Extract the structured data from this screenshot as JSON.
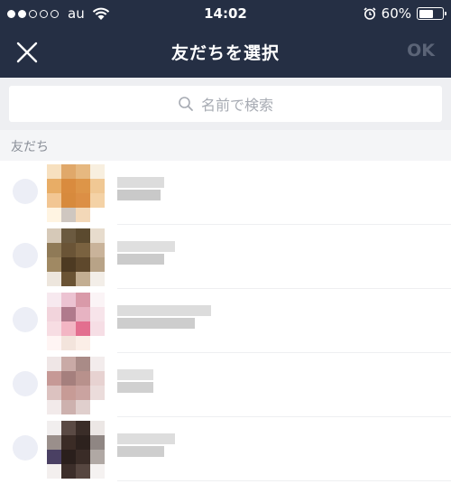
{
  "status_bar": {
    "carrier": "au",
    "time": "14:02",
    "battery": "60%",
    "battery_level": 0.6,
    "signal_filled": 2,
    "signal_total": 5
  },
  "nav": {
    "title": "友だちを選択",
    "ok_label": "OK"
  },
  "search": {
    "placeholder": "名前で検索"
  },
  "section": {
    "label": "友だち"
  },
  "friends": [
    {
      "avatar": [
        "#f7e0bf",
        "#e0a86a",
        "#e6b880",
        "#f8efdf",
        "#e8ad66",
        "#d98b3e",
        "#dd9548",
        "#f0c894",
        "#f2c693",
        "#d78a3d",
        "#dc8f45",
        "#f4d2a6",
        "#fff4e2",
        "#cfc7c0",
        "#f3d8b8",
        "#ffffff"
      ],
      "name": [
        "#dcdcdc",
        "#c9c9c9"
      ]
    },
    {
      "avatar": [
        "#d6c9b8",
        "#6b5a40",
        "#5b4a2f",
        "#e7dccd",
        "#8f7a57",
        "#6a5436",
        "#7a6240",
        "#c9b39a",
        "#a08963",
        "#4d3a22",
        "#5e482c",
        "#b8a387",
        "#ede6dd",
        "#6a5334",
        "#c3ae92",
        "#f3eee8"
      ],
      "name": [
        "#dfdfdf",
        "#cbcbcb"
      ]
    },
    {
      "avatar": [
        "#f7e9ef",
        "#ecc3d2",
        "#d99aa9",
        "#fbf4f6",
        "#f2d4dc",
        "#b07a8c",
        "#e7b3c2",
        "#f7e4ea",
        "#f7dde3",
        "#f3b6c4",
        "#e36f8f",
        "#f6dee5",
        "#fff5f4",
        "#f3e4dc",
        "#fbeee7",
        "#ffffff"
      ],
      "name": [
        "#dcdcdc",
        "#cdcdcd"
      ]
    },
    {
      "avatar": [
        "#efe6e6",
        "#c9aaa6",
        "#a98b87",
        "#f3ecec",
        "#c69996",
        "#a57f7d",
        "#b8918c",
        "#e7d2d1",
        "#dcc2c0",
        "#c79b96",
        "#caa3a0",
        "#ebdcdb",
        "#f2eaea",
        "#cdb1ae",
        "#e0cfcd",
        "#ffffff"
      ],
      "name": [
        "#e0e0e0",
        "#d0d0d0"
      ]
    },
    {
      "avatar": [
        "#f1eeee",
        "#5a4a44",
        "#3a2d28",
        "#ece7e5",
        "#9a8f8b",
        "#3b2c26",
        "#2d221e",
        "#8f8683",
        "#4a4063",
        "#2a1f1c",
        "#3a2c27",
        "#b0a8a4",
        "#f3efee",
        "#3c2e2a",
        "#564640",
        "#f5f2f1"
      ],
      "name": [
        "#dddddd",
        "#cecece"
      ]
    }
  ],
  "colors": {
    "header_bg": "#252f44",
    "ok_disabled": "#5b6477",
    "search_bg": "#eeeff2",
    "section_bg": "#f4f5f7",
    "radio": "#eceef6"
  },
  "icons": {
    "close": "close-icon",
    "search": "search-icon",
    "wifi": "wifi-icon",
    "alarm": "alarm-clock-icon",
    "battery": "battery-icon"
  }
}
